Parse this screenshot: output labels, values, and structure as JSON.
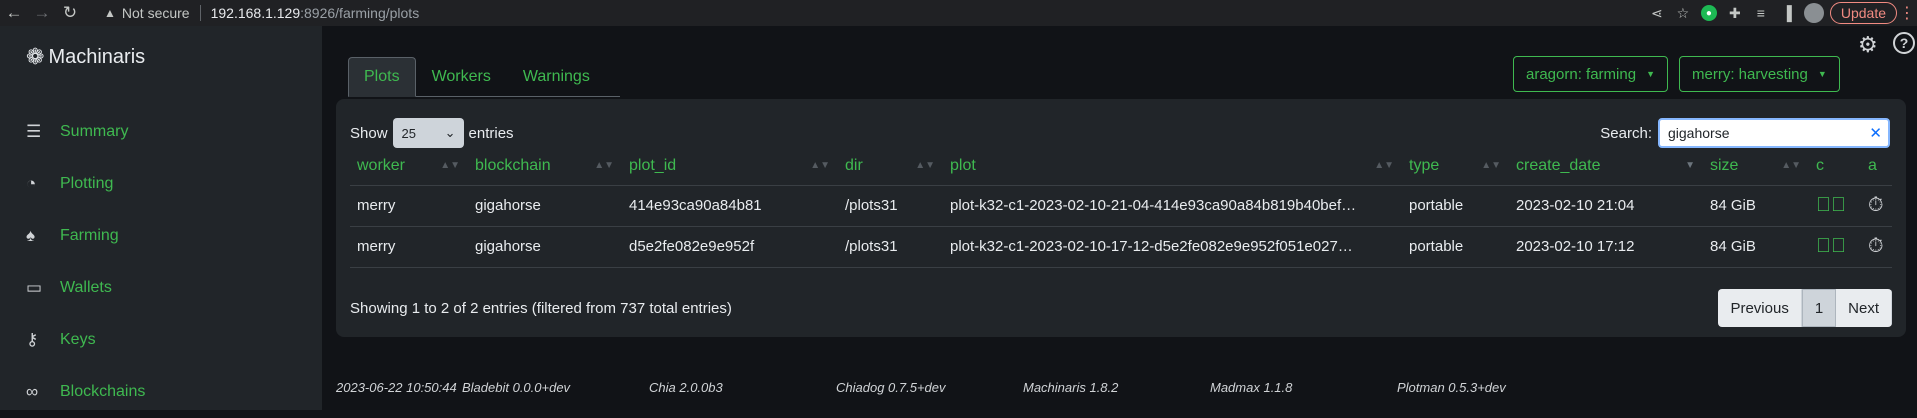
{
  "browser": {
    "url_host": "192.168.1.129",
    "url_rest": ":8926/farming/plots",
    "security_label": "Not secure",
    "update_label": "Update"
  },
  "app": {
    "brand": "Machinaris"
  },
  "sidebar": {
    "items": [
      {
        "label": "Summary",
        "icon": "list-icon"
      },
      {
        "label": "Plotting",
        "icon": "speedometer-icon"
      },
      {
        "label": "Farming",
        "icon": "tree-icon"
      },
      {
        "label": "Wallets",
        "icon": "wallet-icon"
      },
      {
        "label": "Keys",
        "icon": "key-icon"
      },
      {
        "label": "Blockchains",
        "icon": "link-icon"
      }
    ]
  },
  "tabs": [
    {
      "label": "Plots",
      "active": true
    },
    {
      "label": "Workers",
      "active": false
    },
    {
      "label": "Warnings",
      "active": false
    }
  ],
  "workers": [
    {
      "label": "aragorn: farming"
    },
    {
      "label": "merry: harvesting"
    }
  ],
  "table_controls": {
    "show_label": "Show",
    "entries_value": "25",
    "entries_label": "entries",
    "search_label": "Search:",
    "search_value": "gigahorse"
  },
  "columns": [
    "worker",
    "blockchain",
    "plot_id",
    "dir",
    "plot",
    "type",
    "create_date",
    "size",
    "c",
    "a"
  ],
  "rows": [
    {
      "worker": "merry",
      "blockchain": "gigahorse",
      "plot_id": "414e93ca90a84b81",
      "dir": "/plots31",
      "plot": "plot-k32-c1-2023-02-10-21-04-414e93ca90a84b819b40bef…",
      "type": "portable",
      "create_date": "2023-02-10 21:04",
      "size": "84 GiB"
    },
    {
      "worker": "merry",
      "blockchain": "gigahorse",
      "plot_id": "d5e2fe082e9e952f",
      "dir": "/plots31",
      "plot": "plot-k32-c1-2023-02-10-17-12-d5e2fe082e9e952f051e027…",
      "type": "portable",
      "create_date": "2023-02-10 17:12",
      "size": "84 GiB"
    }
  ],
  "table_info": "Showing 1 to 2 of 2 entries (filtered from 737 total entries)",
  "pagination": {
    "previous": "Previous",
    "current": "1",
    "next": "Next"
  },
  "footer": [
    "2023-06-22 10:50:44",
    "Bladebit 0.0.0+dev",
    "Chia 2.0.0b3",
    "Chiadog 0.7.5+dev",
    "Machinaris 1.8.2",
    "Madmax 1.1.8",
    "Plotman 0.5.3+dev"
  ],
  "colors": {
    "accent": "#3fb950",
    "sidebar_bg": "#212529",
    "page_bg": "#111317"
  }
}
